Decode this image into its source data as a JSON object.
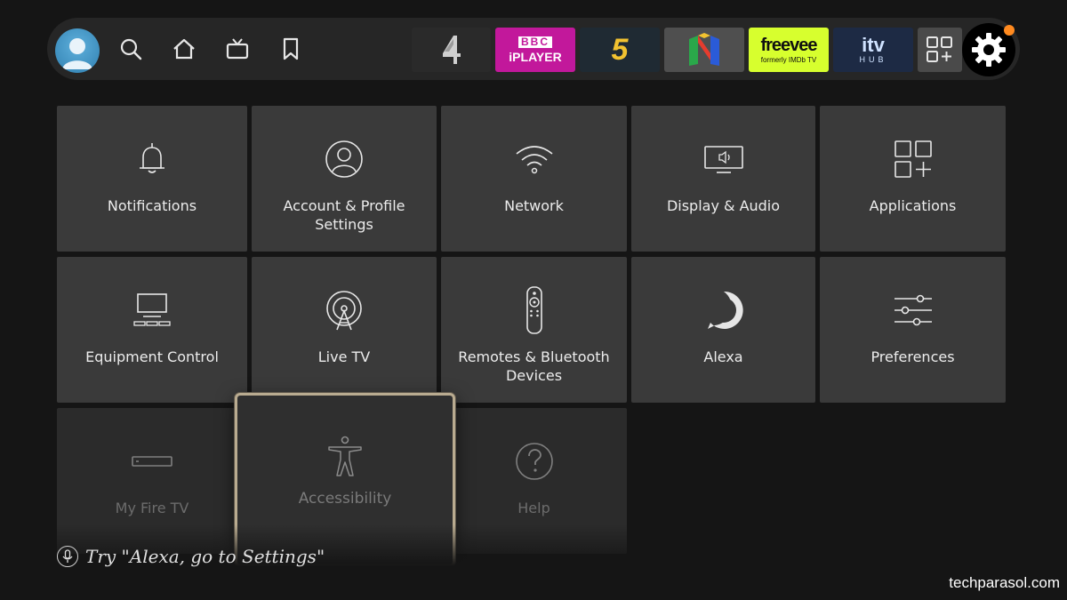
{
  "top_bar": {
    "icons": [
      "profile-avatar",
      "search-icon",
      "home-icon",
      "live-tv-icon",
      "bookmark-icon"
    ],
    "apps": [
      {
        "name": "Channel 4",
        "logo_text": "4",
        "bg": "#2a2a2a",
        "fg": "#d6d6d6"
      },
      {
        "name": "BBC iPlayer",
        "logo_top": "BBC",
        "logo_text": "iPLAYER",
        "bg": "#c2189b",
        "fg": "#ffffff"
      },
      {
        "name": "My5",
        "logo_text": "5",
        "bg": "#1f2a33",
        "fg": "#f2c230"
      },
      {
        "name": "Nintendo 64",
        "logo_text": "N",
        "bg": "#4f4f4f",
        "fg": "#ffffff"
      },
      {
        "name": "Freevee",
        "logo_text": "freevee",
        "logo_sub": "formerly IMDb TV",
        "bg": "#d7ff2e",
        "fg": "#101010"
      },
      {
        "name": "ITV Hub",
        "logo_text": "itv",
        "logo_sub": "HUB",
        "bg": "#1d2a44",
        "fg": "#cfe2ff"
      }
    ],
    "all_apps_icon": "apps-grid-icon",
    "settings_icon": "gear-icon",
    "notification_dot_color": "#ff8a1f"
  },
  "tiles": [
    {
      "label": "Notifications",
      "icon": "bell-icon"
    },
    {
      "label": "Account & Profile Settings",
      "icon": "profile-icon"
    },
    {
      "label": "Network",
      "icon": "wifi-icon"
    },
    {
      "label": "Display & Audio",
      "icon": "display-icon"
    },
    {
      "label": "Applications",
      "icon": "apps-icon"
    },
    {
      "label": "Equipment Control",
      "icon": "equipment-icon"
    },
    {
      "label": "Live TV",
      "icon": "antenna-icon"
    },
    {
      "label": "Remotes & Bluetooth Devices",
      "icon": "remote-icon"
    },
    {
      "label": "Alexa",
      "icon": "alexa-icon"
    },
    {
      "label": "Preferences",
      "icon": "sliders-icon"
    },
    {
      "label": "My Fire TV",
      "icon": "firetv-stick-icon"
    },
    {
      "label": "Accessibility",
      "icon": "accessibility-icon"
    },
    {
      "label": "Help",
      "icon": "help-icon"
    }
  ],
  "hint": {
    "text": "Try \"Alexa, go to Settings\"",
    "icon": "microphone-icon"
  },
  "watermark": "techparasol.com"
}
